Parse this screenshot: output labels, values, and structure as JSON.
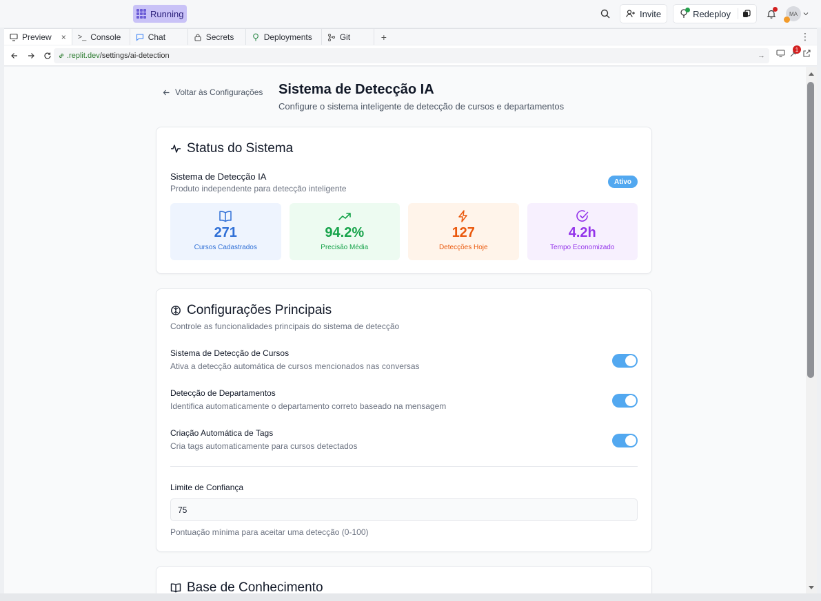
{
  "topbar": {
    "run_label": "Running",
    "invite_label": "Invite",
    "redeploy_label": "Redeploy",
    "avatar_initials": "MA"
  },
  "tabs": [
    {
      "label": "Preview",
      "icon": "monitor-icon"
    },
    {
      "label": "Console",
      "icon": "terminal-icon"
    },
    {
      "label": "Chat",
      "icon": "chat-icon"
    },
    {
      "label": "Secrets",
      "icon": "lock-icon"
    },
    {
      "label": "Deployments",
      "icon": "deploy-icon"
    },
    {
      "label": "Git",
      "icon": "git-icon"
    }
  ],
  "address": {
    "domain": ".replit.dev",
    "path": "/settings/ai-detection",
    "notification_count": "1"
  },
  "page": {
    "back_label": "Voltar às Configurações",
    "title": "Sistema de Detecção IA",
    "subtitle": "Configure o sistema inteligente de detecção de cursos e departamentos"
  },
  "status": {
    "title": "Status do Sistema",
    "system_name": "Sistema de Detecção IA",
    "system_desc": "Produto independente para detecção inteligente",
    "pill": "Ativo",
    "stats": [
      {
        "value": "271",
        "label": "Cursos Cadastrados",
        "color": "#2f6fd6",
        "bg": "#eef4fe",
        "icon": "book-icon"
      },
      {
        "value": "94.2%",
        "label": "Precisão Média",
        "color": "#16a34a",
        "bg": "#edfbf1",
        "icon": "trending-up-icon"
      },
      {
        "value": "127",
        "label": "Detecções Hoje",
        "color": "#ea580c",
        "bg": "#fff4ea",
        "icon": "zap-icon"
      },
      {
        "value": "4.2h",
        "label": "Tempo Economizado",
        "color": "#9333ea",
        "bg": "#f7f0fe",
        "icon": "check-circle-icon"
      }
    ]
  },
  "config": {
    "title": "Configurações Principais",
    "desc": "Controle as funcionalidades principais do sistema de detecção",
    "settings": [
      {
        "title": "Sistema de Detecção de Cursos",
        "desc": "Ativa a detecção automática de cursos mencionados nas conversas",
        "enabled": true
      },
      {
        "title": "Detecção de Departamentos",
        "desc": "Identifica automaticamente o departamento correto baseado na mensagem",
        "enabled": true
      },
      {
        "title": "Criação Automática de Tags",
        "desc": "Cria tags automaticamente para cursos detectados",
        "enabled": true
      }
    ],
    "limit_label": "Limite de Confiança",
    "limit_value": "75",
    "limit_help": "Pontuação mínima para aceitar uma detecção (0-100)"
  },
  "knowledge": {
    "title": "Base de Conhecimento"
  }
}
